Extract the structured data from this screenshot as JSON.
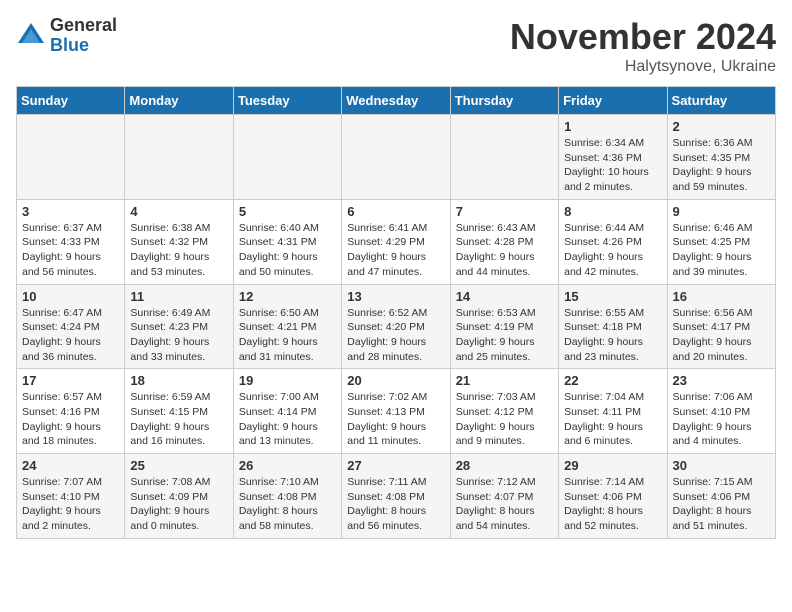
{
  "logo": {
    "general": "General",
    "blue": "Blue"
  },
  "title": "November 2024",
  "location": "Halytsynove, Ukraine",
  "weekdays": [
    "Sunday",
    "Monday",
    "Tuesday",
    "Wednesday",
    "Thursday",
    "Friday",
    "Saturday"
  ],
  "weeks": [
    [
      {
        "day": "",
        "sunrise": "",
        "sunset": "",
        "daylight": ""
      },
      {
        "day": "",
        "sunrise": "",
        "sunset": "",
        "daylight": ""
      },
      {
        "day": "",
        "sunrise": "",
        "sunset": "",
        "daylight": ""
      },
      {
        "day": "",
        "sunrise": "",
        "sunset": "",
        "daylight": ""
      },
      {
        "day": "",
        "sunrise": "",
        "sunset": "",
        "daylight": ""
      },
      {
        "day": "1",
        "sunrise": "Sunrise: 6:34 AM",
        "sunset": "Sunset: 4:36 PM",
        "daylight": "Daylight: 10 hours and 2 minutes."
      },
      {
        "day": "2",
        "sunrise": "Sunrise: 6:36 AM",
        "sunset": "Sunset: 4:35 PM",
        "daylight": "Daylight: 9 hours and 59 minutes."
      }
    ],
    [
      {
        "day": "3",
        "sunrise": "Sunrise: 6:37 AM",
        "sunset": "Sunset: 4:33 PM",
        "daylight": "Daylight: 9 hours and 56 minutes."
      },
      {
        "day": "4",
        "sunrise": "Sunrise: 6:38 AM",
        "sunset": "Sunset: 4:32 PM",
        "daylight": "Daylight: 9 hours and 53 minutes."
      },
      {
        "day": "5",
        "sunrise": "Sunrise: 6:40 AM",
        "sunset": "Sunset: 4:31 PM",
        "daylight": "Daylight: 9 hours and 50 minutes."
      },
      {
        "day": "6",
        "sunrise": "Sunrise: 6:41 AM",
        "sunset": "Sunset: 4:29 PM",
        "daylight": "Daylight: 9 hours and 47 minutes."
      },
      {
        "day": "7",
        "sunrise": "Sunrise: 6:43 AM",
        "sunset": "Sunset: 4:28 PM",
        "daylight": "Daylight: 9 hours and 44 minutes."
      },
      {
        "day": "8",
        "sunrise": "Sunrise: 6:44 AM",
        "sunset": "Sunset: 4:26 PM",
        "daylight": "Daylight: 9 hours and 42 minutes."
      },
      {
        "day": "9",
        "sunrise": "Sunrise: 6:46 AM",
        "sunset": "Sunset: 4:25 PM",
        "daylight": "Daylight: 9 hours and 39 minutes."
      }
    ],
    [
      {
        "day": "10",
        "sunrise": "Sunrise: 6:47 AM",
        "sunset": "Sunset: 4:24 PM",
        "daylight": "Daylight: 9 hours and 36 minutes."
      },
      {
        "day": "11",
        "sunrise": "Sunrise: 6:49 AM",
        "sunset": "Sunset: 4:23 PM",
        "daylight": "Daylight: 9 hours and 33 minutes."
      },
      {
        "day": "12",
        "sunrise": "Sunrise: 6:50 AM",
        "sunset": "Sunset: 4:21 PM",
        "daylight": "Daylight: 9 hours and 31 minutes."
      },
      {
        "day": "13",
        "sunrise": "Sunrise: 6:52 AM",
        "sunset": "Sunset: 4:20 PM",
        "daylight": "Daylight: 9 hours and 28 minutes."
      },
      {
        "day": "14",
        "sunrise": "Sunrise: 6:53 AM",
        "sunset": "Sunset: 4:19 PM",
        "daylight": "Daylight: 9 hours and 25 minutes."
      },
      {
        "day": "15",
        "sunrise": "Sunrise: 6:55 AM",
        "sunset": "Sunset: 4:18 PM",
        "daylight": "Daylight: 9 hours and 23 minutes."
      },
      {
        "day": "16",
        "sunrise": "Sunrise: 6:56 AM",
        "sunset": "Sunset: 4:17 PM",
        "daylight": "Daylight: 9 hours and 20 minutes."
      }
    ],
    [
      {
        "day": "17",
        "sunrise": "Sunrise: 6:57 AM",
        "sunset": "Sunset: 4:16 PM",
        "daylight": "Daylight: 9 hours and 18 minutes."
      },
      {
        "day": "18",
        "sunrise": "Sunrise: 6:59 AM",
        "sunset": "Sunset: 4:15 PM",
        "daylight": "Daylight: 9 hours and 16 minutes."
      },
      {
        "day": "19",
        "sunrise": "Sunrise: 7:00 AM",
        "sunset": "Sunset: 4:14 PM",
        "daylight": "Daylight: 9 hours and 13 minutes."
      },
      {
        "day": "20",
        "sunrise": "Sunrise: 7:02 AM",
        "sunset": "Sunset: 4:13 PM",
        "daylight": "Daylight: 9 hours and 11 minutes."
      },
      {
        "day": "21",
        "sunrise": "Sunrise: 7:03 AM",
        "sunset": "Sunset: 4:12 PM",
        "daylight": "Daylight: 9 hours and 9 minutes."
      },
      {
        "day": "22",
        "sunrise": "Sunrise: 7:04 AM",
        "sunset": "Sunset: 4:11 PM",
        "daylight": "Daylight: 9 hours and 6 minutes."
      },
      {
        "day": "23",
        "sunrise": "Sunrise: 7:06 AM",
        "sunset": "Sunset: 4:10 PM",
        "daylight": "Daylight: 9 hours and 4 minutes."
      }
    ],
    [
      {
        "day": "24",
        "sunrise": "Sunrise: 7:07 AM",
        "sunset": "Sunset: 4:10 PM",
        "daylight": "Daylight: 9 hours and 2 minutes."
      },
      {
        "day": "25",
        "sunrise": "Sunrise: 7:08 AM",
        "sunset": "Sunset: 4:09 PM",
        "daylight": "Daylight: 9 hours and 0 minutes."
      },
      {
        "day": "26",
        "sunrise": "Sunrise: 7:10 AM",
        "sunset": "Sunset: 4:08 PM",
        "daylight": "Daylight: 8 hours and 58 minutes."
      },
      {
        "day": "27",
        "sunrise": "Sunrise: 7:11 AM",
        "sunset": "Sunset: 4:08 PM",
        "daylight": "Daylight: 8 hours and 56 minutes."
      },
      {
        "day": "28",
        "sunrise": "Sunrise: 7:12 AM",
        "sunset": "Sunset: 4:07 PM",
        "daylight": "Daylight: 8 hours and 54 minutes."
      },
      {
        "day": "29",
        "sunrise": "Sunrise: 7:14 AM",
        "sunset": "Sunset: 4:06 PM",
        "daylight": "Daylight: 8 hours and 52 minutes."
      },
      {
        "day": "30",
        "sunrise": "Sunrise: 7:15 AM",
        "sunset": "Sunset: 4:06 PM",
        "daylight": "Daylight: 8 hours and 51 minutes."
      }
    ]
  ]
}
